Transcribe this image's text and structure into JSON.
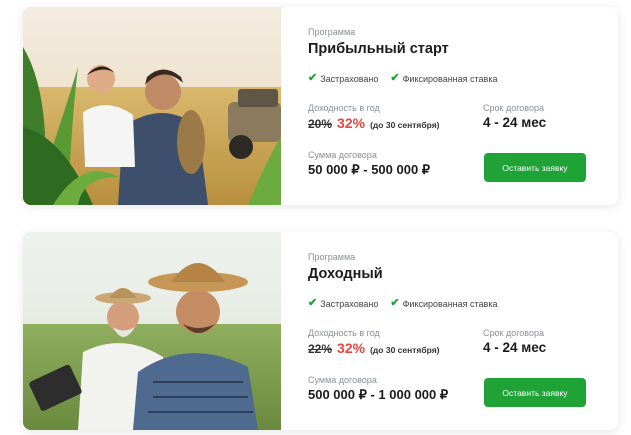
{
  "colors": {
    "accent": "#1fa336",
    "rate": "#e8453c"
  },
  "cards": [
    {
      "program_label": "Программа",
      "title": "Прибыльный старт",
      "tags": [
        "Застраховано",
        "Фиксированная ставка"
      ],
      "yield_label": "Доходность в год",
      "old_rate": "20%",
      "new_rate": "32%",
      "rate_note": "(до 30 сентября)",
      "term_label": "Срок договора",
      "term": "4 - 24 мес",
      "sum_label": "Сумма договора",
      "sum": "50 000 ₽  - 500 000 ₽",
      "button": "Оставить заявку"
    },
    {
      "program_label": "Программа",
      "title": "Доходный",
      "tags": [
        "Застраховано",
        "Фиксированная ставка"
      ],
      "yield_label": "Доходность в год",
      "old_rate": "22%",
      "new_rate": "32%",
      "rate_note": "(до 30 сентября)",
      "term_label": "Срок договора",
      "term": "4 - 24 мес",
      "sum_label": "Сумма договора",
      "sum": "500 000 ₽  - 1 000 000 ₽",
      "button": "Оставить заявку"
    }
  ]
}
